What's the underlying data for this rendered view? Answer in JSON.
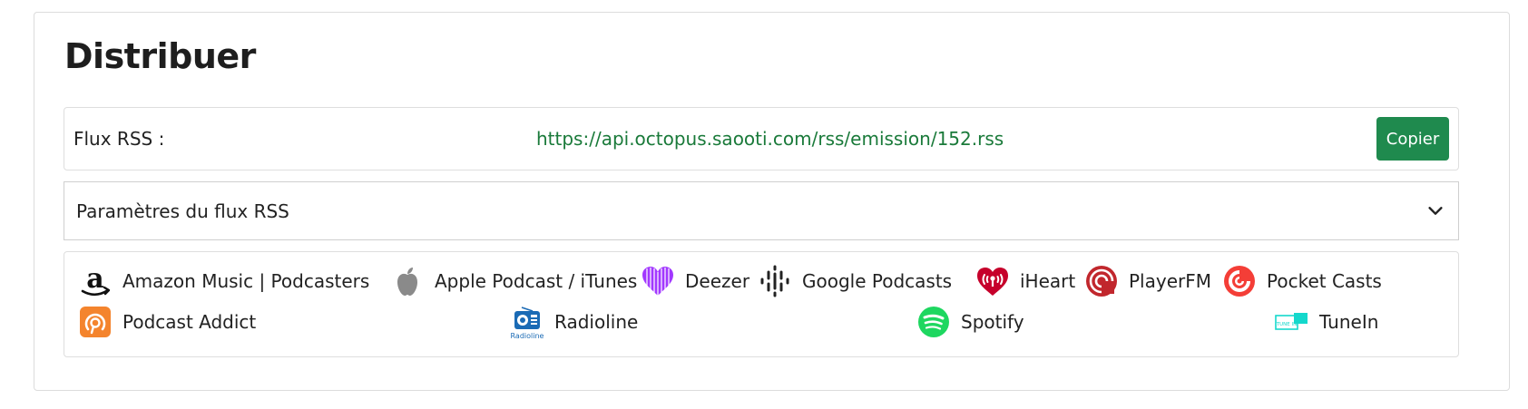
{
  "section": {
    "title": "Distribuer"
  },
  "rss": {
    "label": "Flux RSS :",
    "url": "https://api.octopus.saooti.com/rss/emission/152.rss",
    "copy_label": "Copier"
  },
  "params": {
    "label": "Paramètres du flux RSS"
  },
  "platforms": [
    {
      "label": "Amazon Music | Podcasters",
      "icon": "amazon-icon"
    },
    {
      "label": "Apple Podcast / iTunes",
      "icon": "apple-icon"
    },
    {
      "label": "Deezer",
      "icon": "deezer-icon"
    },
    {
      "label": "Google Podcasts",
      "icon": "google-podcasts-icon"
    },
    {
      "label": "iHeart",
      "icon": "iheart-icon"
    },
    {
      "label": "PlayerFM",
      "icon": "playerfm-icon"
    },
    {
      "label": "Pocket Casts",
      "icon": "pocket-casts-icon"
    },
    {
      "label": "Podcast Addict",
      "icon": "podcast-addict-icon"
    },
    {
      "label": "Radioline",
      "icon": "radioline-icon"
    },
    {
      "label": "Spotify",
      "icon": "spotify-icon"
    },
    {
      "label": "TuneIn",
      "icon": "tunein-icon"
    }
  ],
  "icon_text": {
    "radioline": "Radioline",
    "tunein": "TUNE IN"
  },
  "colors": {
    "url_green": "#1a7a3a",
    "button_green": "#1f8a4e",
    "deezer_purple": "#a238ff",
    "iheart_red": "#c6002b",
    "playerfm_red": "#c1272d",
    "pocket_casts_red": "#f43e37",
    "podcast_addict_orange": "#f4842d",
    "spotify_green": "#1ed760",
    "radioline_blue": "#1b6bb5",
    "tunein_teal": "#14d8cc"
  }
}
